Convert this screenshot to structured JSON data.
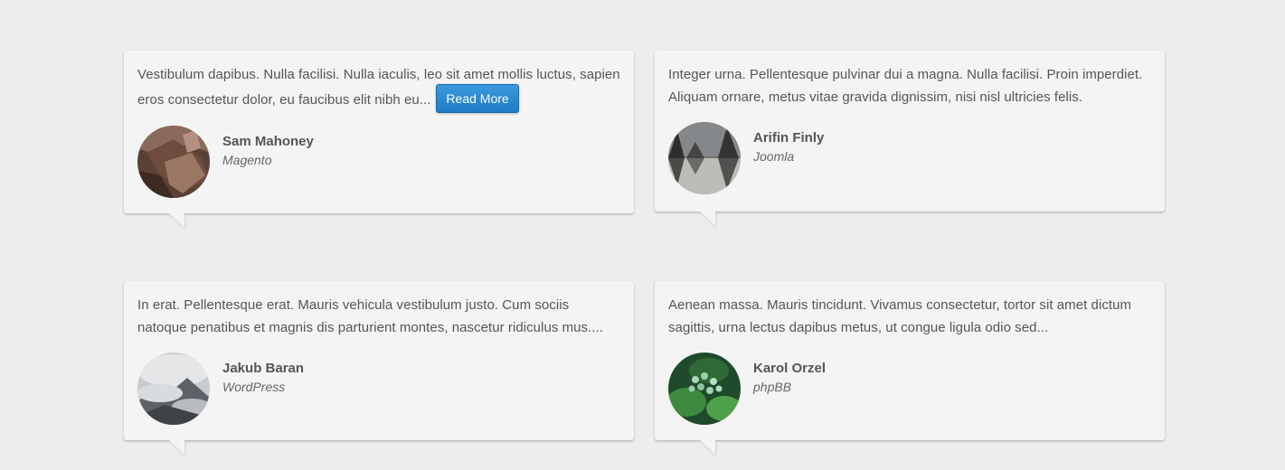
{
  "testimonials": [
    {
      "quote": "Vestibulum dapibus. Nulla facilisi. Nulla iaculis, leo sit amet mollis luctus, sapien eros consectetur dolor, eu faucibus elit nibh eu...",
      "read_more_label": "Read More",
      "name": "Sam Mahoney",
      "role": "Magento",
      "avatar": "rock-cliff-photo"
    },
    {
      "quote": "Integer urna. Pellentesque pulvinar dui a magna. Nulla facilisi. Proin imperdiet. Aliquam ornare, metus vitae gravida dignissim, nisi nisl ultricies felis.",
      "name": "Arifin Finly",
      "role": "Joomla",
      "avatar": "forest-lake-photo"
    },
    {
      "quote": "In erat. Pellentesque erat. Mauris vehicula vestibulum justo. Cum sociis natoque penatibus et magnis dis parturient montes, nascetur ridiculus mus....",
      "name": "Jakub Baran",
      "role": "WordPress",
      "avatar": "misty-mountain-photo"
    },
    {
      "quote": "Aenean massa. Mauris tincidunt. Vivamus consectetur, tortor sit amet dictum sagittis, urna lectus dapibus metus, ut congue ligula odio sed...",
      "name": "Karol Orzel",
      "role": "phpBB",
      "avatar": "green-plant-photo"
    }
  ],
  "colors": {
    "background": "#ededed",
    "card": "#f4f4f4",
    "text": "#555555",
    "button": "#2a88d0"
  }
}
